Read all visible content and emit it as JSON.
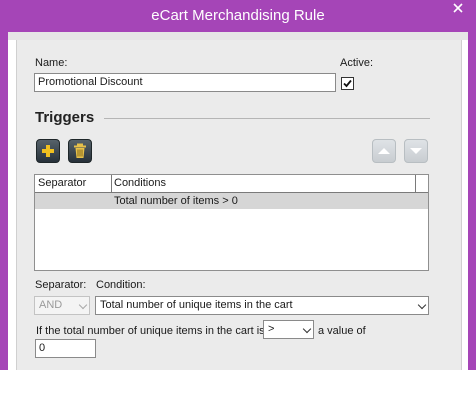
{
  "window": {
    "title": "eCart Merchandising Rule"
  },
  "form": {
    "name_label": "Name:",
    "name_value": "Promotional Discount",
    "active_label": "Active:",
    "active_checked": true
  },
  "triggers": {
    "section_title": "Triggers",
    "toolbar": {
      "add_icon": "plus-icon",
      "delete_icon": "trash-icon",
      "move_up_icon": "arrow-up-icon",
      "move_down_icon": "arrow-down-icon"
    },
    "columns": [
      "Separator",
      "Conditions"
    ],
    "rows": [
      {
        "separator": "",
        "condition": "Total number of items > 0"
      }
    ]
  },
  "editor": {
    "separator_label": "Separator:",
    "separator_value": "AND",
    "condition_label": "Condition:",
    "condition_value": "Total number of unique items in the cart",
    "sentence_prefix": "If the total number of unique items in the cart is",
    "operator_value": ">",
    "sentence_suffix": "a value of",
    "value": "0"
  }
}
